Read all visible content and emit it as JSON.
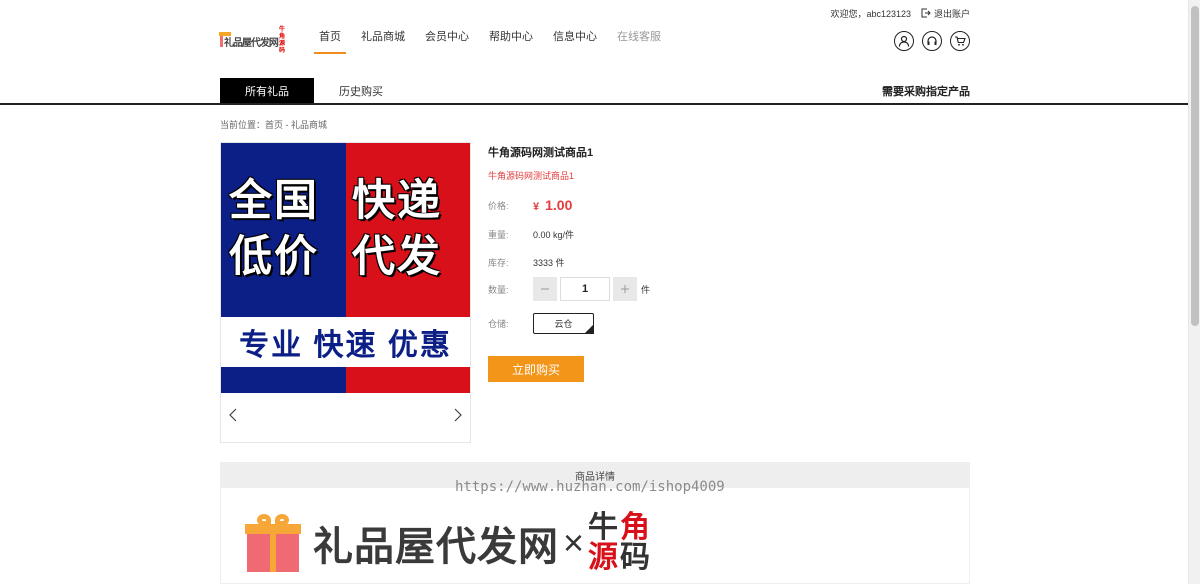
{
  "topbar": {
    "welcome": "欢迎您，abc123123",
    "logout": "退出账户"
  },
  "logo": {
    "text": "礼品屋代发网",
    "mini": "牛角源码"
  },
  "nav": [
    {
      "label": "首页",
      "active": true
    },
    {
      "label": "礼品商城"
    },
    {
      "label": "会员中心"
    },
    {
      "label": "帮助中心"
    },
    {
      "label": "信息中心"
    },
    {
      "label": "在线客服",
      "disabled": true
    }
  ],
  "header_icons": [
    "user-icon",
    "headset-icon",
    "cart-icon"
  ],
  "tabs": {
    "all": "所有礼品",
    "history": "历史购买",
    "right": "需要采购指定产品"
  },
  "breadcrumb": "当前位置：首页 - 礼品商城",
  "banner": {
    "left_text": "全国低价",
    "right_text": "快递代发",
    "strip": "专业 快速 优惠",
    "colors": {
      "blue": "#0b1f86",
      "red": "#d8101a"
    }
  },
  "product": {
    "title": "牛角源码网测试商品1",
    "subtitle": "牛角源码网测试商品1",
    "price_label": "价格:",
    "currency": "¥",
    "price": "1.00",
    "weight_label": "重量:",
    "weight": "0.00 kg/件",
    "stock_label": "库存:",
    "stock": "3333 件",
    "qty_label": "数量:",
    "qty": "1",
    "qty_unit": "件",
    "warehouse_label": "仓储:",
    "warehouse": "云仓",
    "buy": "立即购买"
  },
  "detail": {
    "header": "商品详情",
    "watermark": "https://www.huzhan.com/ishop4009",
    "brand_name": "礼品屋代发网",
    "times": "×",
    "brand_chars": [
      "牛",
      "角",
      "源",
      "码"
    ]
  },
  "accent": "#f39519"
}
